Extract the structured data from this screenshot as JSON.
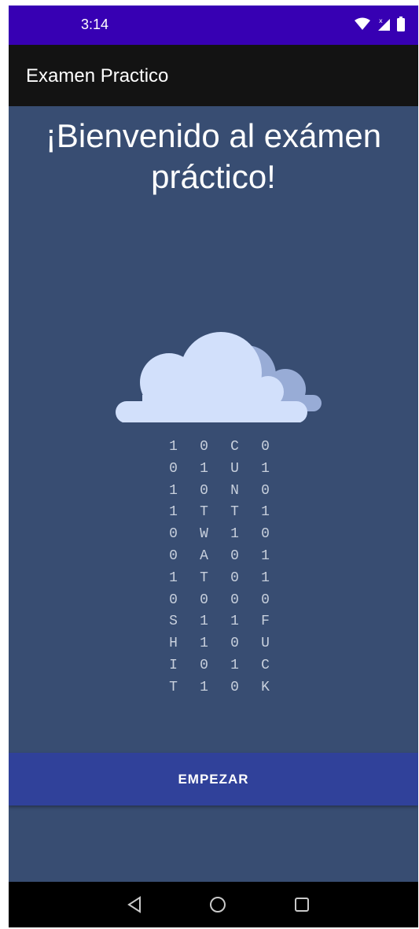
{
  "status_bar": {
    "time": "3:14",
    "icons": [
      "wifi-icon",
      "signal-icon",
      "battery-icon"
    ],
    "background": "#3700b3"
  },
  "app_bar": {
    "title": "Examen Practico",
    "background": "#131313"
  },
  "main": {
    "welcome_line1": "¡Bienvenido al exámen",
    "welcome_line2": "práctico!",
    "illustration": "cloud-icon",
    "binary_rows": [
      [
        "1",
        "0",
        "C",
        "0"
      ],
      [
        "0",
        "1",
        "U",
        "1"
      ],
      [
        "1",
        "0",
        "N",
        "0"
      ],
      [
        "1",
        "T",
        "T",
        "1"
      ],
      [
        "0",
        "W",
        "1",
        "0"
      ],
      [
        "0",
        "A",
        "0",
        "1"
      ],
      [
        "1",
        "T",
        "0",
        "1"
      ],
      [
        "0",
        "0",
        "0",
        "0"
      ],
      [
        "S",
        "1",
        "1",
        "F"
      ],
      [
        "H",
        "1",
        "0",
        "U"
      ],
      [
        "I",
        "0",
        "1",
        "C"
      ],
      [
        "T",
        "1",
        "0",
        "K"
      ]
    ],
    "background": "#384d72"
  },
  "actions": {
    "start_label": "EMPEZAR",
    "button_color": "#30419a"
  },
  "nav_bar": {
    "items": [
      "back-icon",
      "home-icon",
      "recents-icon"
    ]
  }
}
